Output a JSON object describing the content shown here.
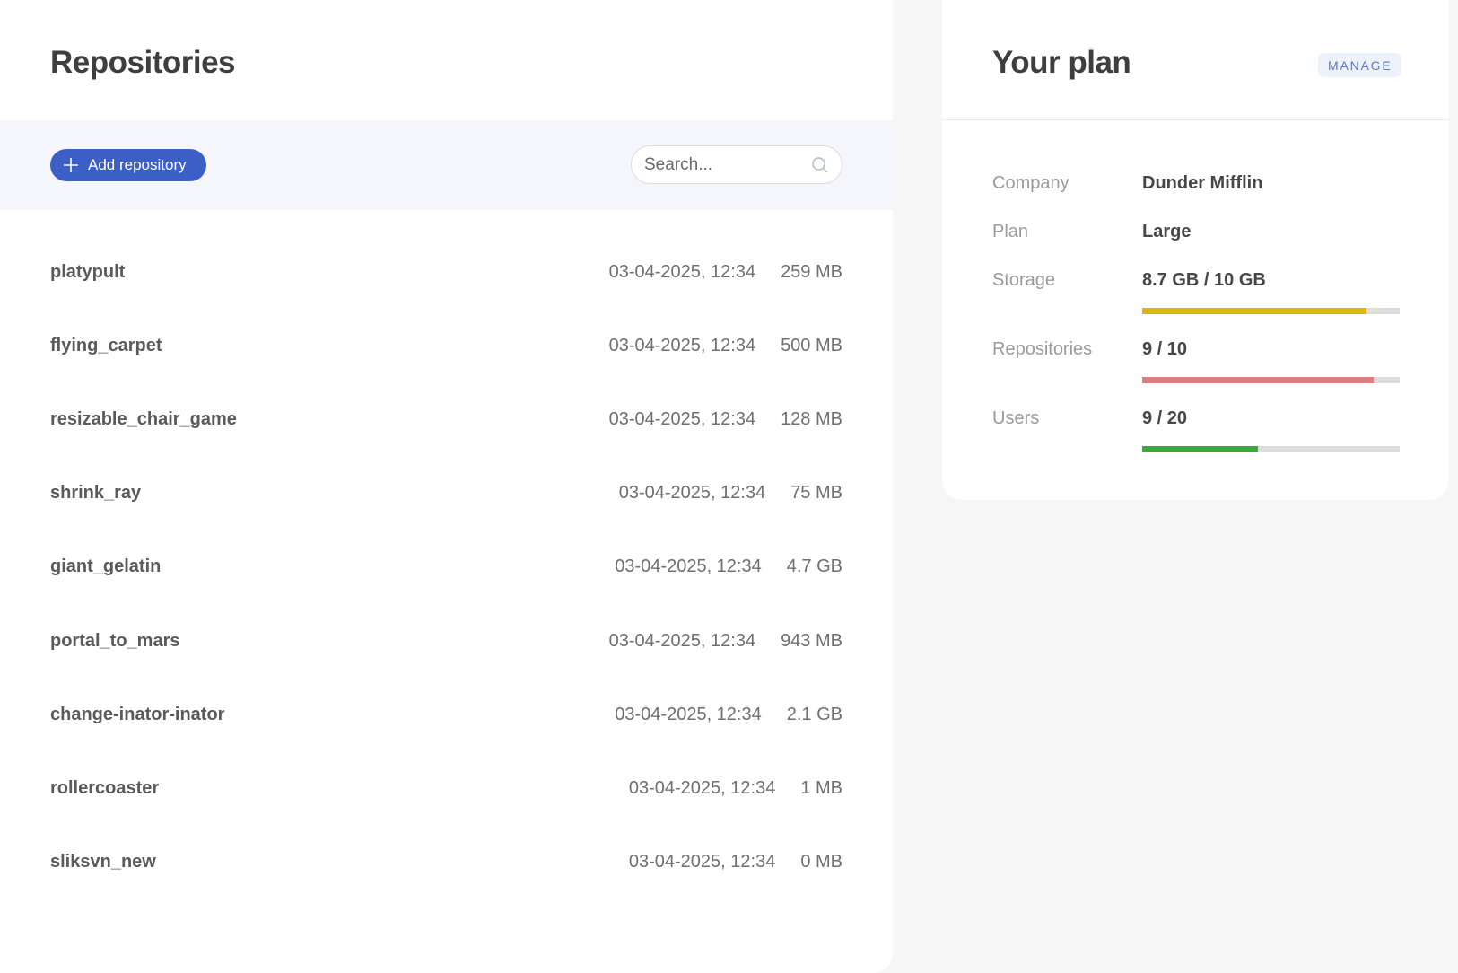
{
  "repositories": {
    "title": "Repositories",
    "add_label": "Add repository",
    "search_placeholder": "Search...",
    "items": [
      {
        "name": "platypult",
        "date": "03-04-2025, 12:34",
        "size": "259 MB"
      },
      {
        "name": "flying_carpet",
        "date": "03-04-2025, 12:34",
        "size": "500 MB"
      },
      {
        "name": "resizable_chair_game",
        "date": "03-04-2025, 12:34",
        "size": "128 MB"
      },
      {
        "name": "shrink_ray",
        "date": "03-04-2025, 12:34",
        "size": "75 MB"
      },
      {
        "name": "giant_gelatin",
        "date": "03-04-2025, 12:34",
        "size": "4.7 GB"
      },
      {
        "name": "portal_to_mars",
        "date": "03-04-2025, 12:34",
        "size": "943 MB"
      },
      {
        "name": "change-inator-inator",
        "date": "03-04-2025, 12:34",
        "size": "2.1 GB"
      },
      {
        "name": "rollercoaster",
        "date": "03-04-2025, 12:34",
        "size": "1 MB"
      },
      {
        "name": "sliksvn_new",
        "date": "03-04-2025, 12:34",
        "size": "0 MB"
      }
    ]
  },
  "plan": {
    "title": "Your plan",
    "manage_label": "MANAGE",
    "company": {
      "label": "Company",
      "value": "Dunder Mifflin"
    },
    "plan": {
      "label": "Plan",
      "value": "Large"
    },
    "storage": {
      "label": "Storage",
      "value": "8.7 GB / 10 GB",
      "fraction": 0.87,
      "color": "#e0b607"
    },
    "repositories": {
      "label": "Repositories",
      "value": "9 / 10",
      "fraction": 0.9,
      "color": "#d97f7f"
    },
    "users": {
      "label": "Users",
      "value": "9 / 20",
      "fraction": 0.45,
      "color": "#3aa83a"
    }
  },
  "colors": {
    "accent": "#3c5fc7",
    "manage_bg": "#edf1f9",
    "manage_text": "#5b78c4"
  },
  "icons": {
    "add": "plus-icon",
    "search": "search-icon"
  }
}
